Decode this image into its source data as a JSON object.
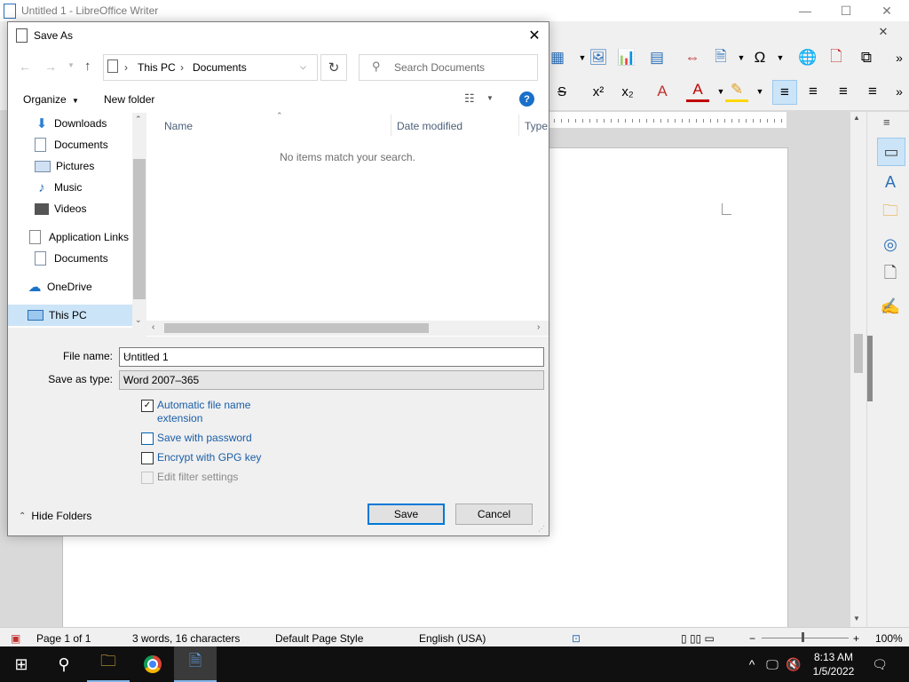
{
  "window": {
    "title": "Untitled 1 - LibreOffice Writer",
    "controls": {
      "minimize": "—",
      "maximize": "☐",
      "close": "✕"
    },
    "close_doc": "✕"
  },
  "statusbar": {
    "page": "Page 1 of 1",
    "words": "3 words, 16 characters",
    "style": "Default Page Style",
    "language": "English (USA)",
    "zoom": "100%"
  },
  "taskbar": {
    "time": "8:13 AM",
    "date": "1/5/2022"
  },
  "dialog": {
    "title": "Save As",
    "address": {
      "root": "This PC",
      "sep1": "›",
      "folder": "Documents",
      "sep0": "›"
    },
    "search_placeholder": "Search Documents",
    "organize": "Organize",
    "new_folder": "New folder",
    "nav_items": {
      "downloads": "Downloads",
      "documents": "Documents",
      "pictures": "Pictures",
      "music": "Music",
      "videos": "Videos",
      "app_links": "Application Links",
      "documents2": "Documents",
      "onedrive": "OneDrive",
      "this_pc": "This PC"
    },
    "columns": {
      "name": "Name",
      "date": "Date modified",
      "type": "Type"
    },
    "empty_message": "No items match your search.",
    "file_name_label": "File name:",
    "file_name_value": "Untitled 1",
    "save_type_label": "Save as type:",
    "save_type_value": "Word 2007–365",
    "options": {
      "auto_ext_line1": "Automatic file name",
      "auto_ext_line2": "extension",
      "save_password": "Save with password",
      "gpg": "Encrypt with GPG key",
      "filter": "Edit filter settings"
    },
    "hide_folders": "Hide Folders",
    "save": "Save",
    "cancel": "Cancel"
  },
  "colors": {
    "accent": "#0078d7",
    "link_blue": "#1a5ea8",
    "taskbar": "#101010"
  }
}
